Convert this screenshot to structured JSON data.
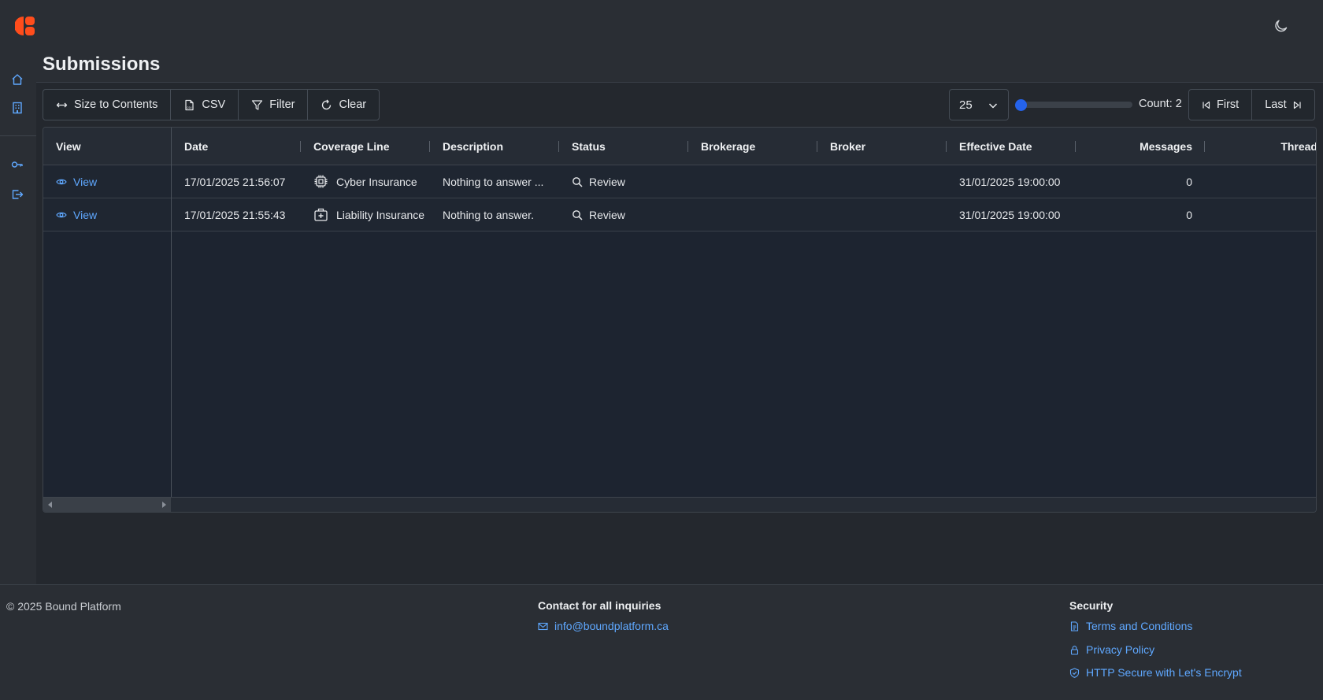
{
  "page": {
    "title": "Submissions"
  },
  "toolbar": {
    "size_to_contents": "Size to Contents",
    "csv": "CSV",
    "filter": "Filter",
    "clear": "Clear"
  },
  "pagination": {
    "page_size": "25",
    "count_label": "Count: 2",
    "first": "First",
    "last": "Last"
  },
  "grid": {
    "columns": [
      "View",
      "Date",
      "Coverage Line",
      "Description",
      "Status",
      "Brokerage",
      "Broker",
      "Effective Date",
      "Messages",
      "Thread"
    ],
    "rows": [
      {
        "view": "View",
        "date": "17/01/2025 21:56:07",
        "coverage_line": "Cyber Insurance",
        "coverage_icon": "chip-icon",
        "description": "Nothing to answer ...",
        "status": "Review",
        "brokerage": "",
        "broker": "",
        "effective_date": "31/01/2025 19:00:00",
        "messages": "0"
      },
      {
        "view": "View",
        "date": "17/01/2025 21:55:43",
        "coverage_line": "Liability Insurance",
        "coverage_icon": "medical-kit-icon",
        "description": "Nothing to answer.",
        "status": "Review",
        "brokerage": "",
        "broker": "",
        "effective_date": "31/01/2025 19:00:00",
        "messages": "0"
      }
    ]
  },
  "footer": {
    "copyright": "© 2025 Bound Platform",
    "contact_heading": "Contact for all inquiries",
    "contact_email": "info@boundplatform.ca",
    "security_heading": "Security",
    "terms": "Terms and Conditions",
    "privacy": "Privacy Policy",
    "https": "HTTP Secure with Let's Encrypt"
  },
  "colors": {
    "accent": "#5fa8ff",
    "brand": "#ff4d1c",
    "slider": "#2563eb"
  }
}
